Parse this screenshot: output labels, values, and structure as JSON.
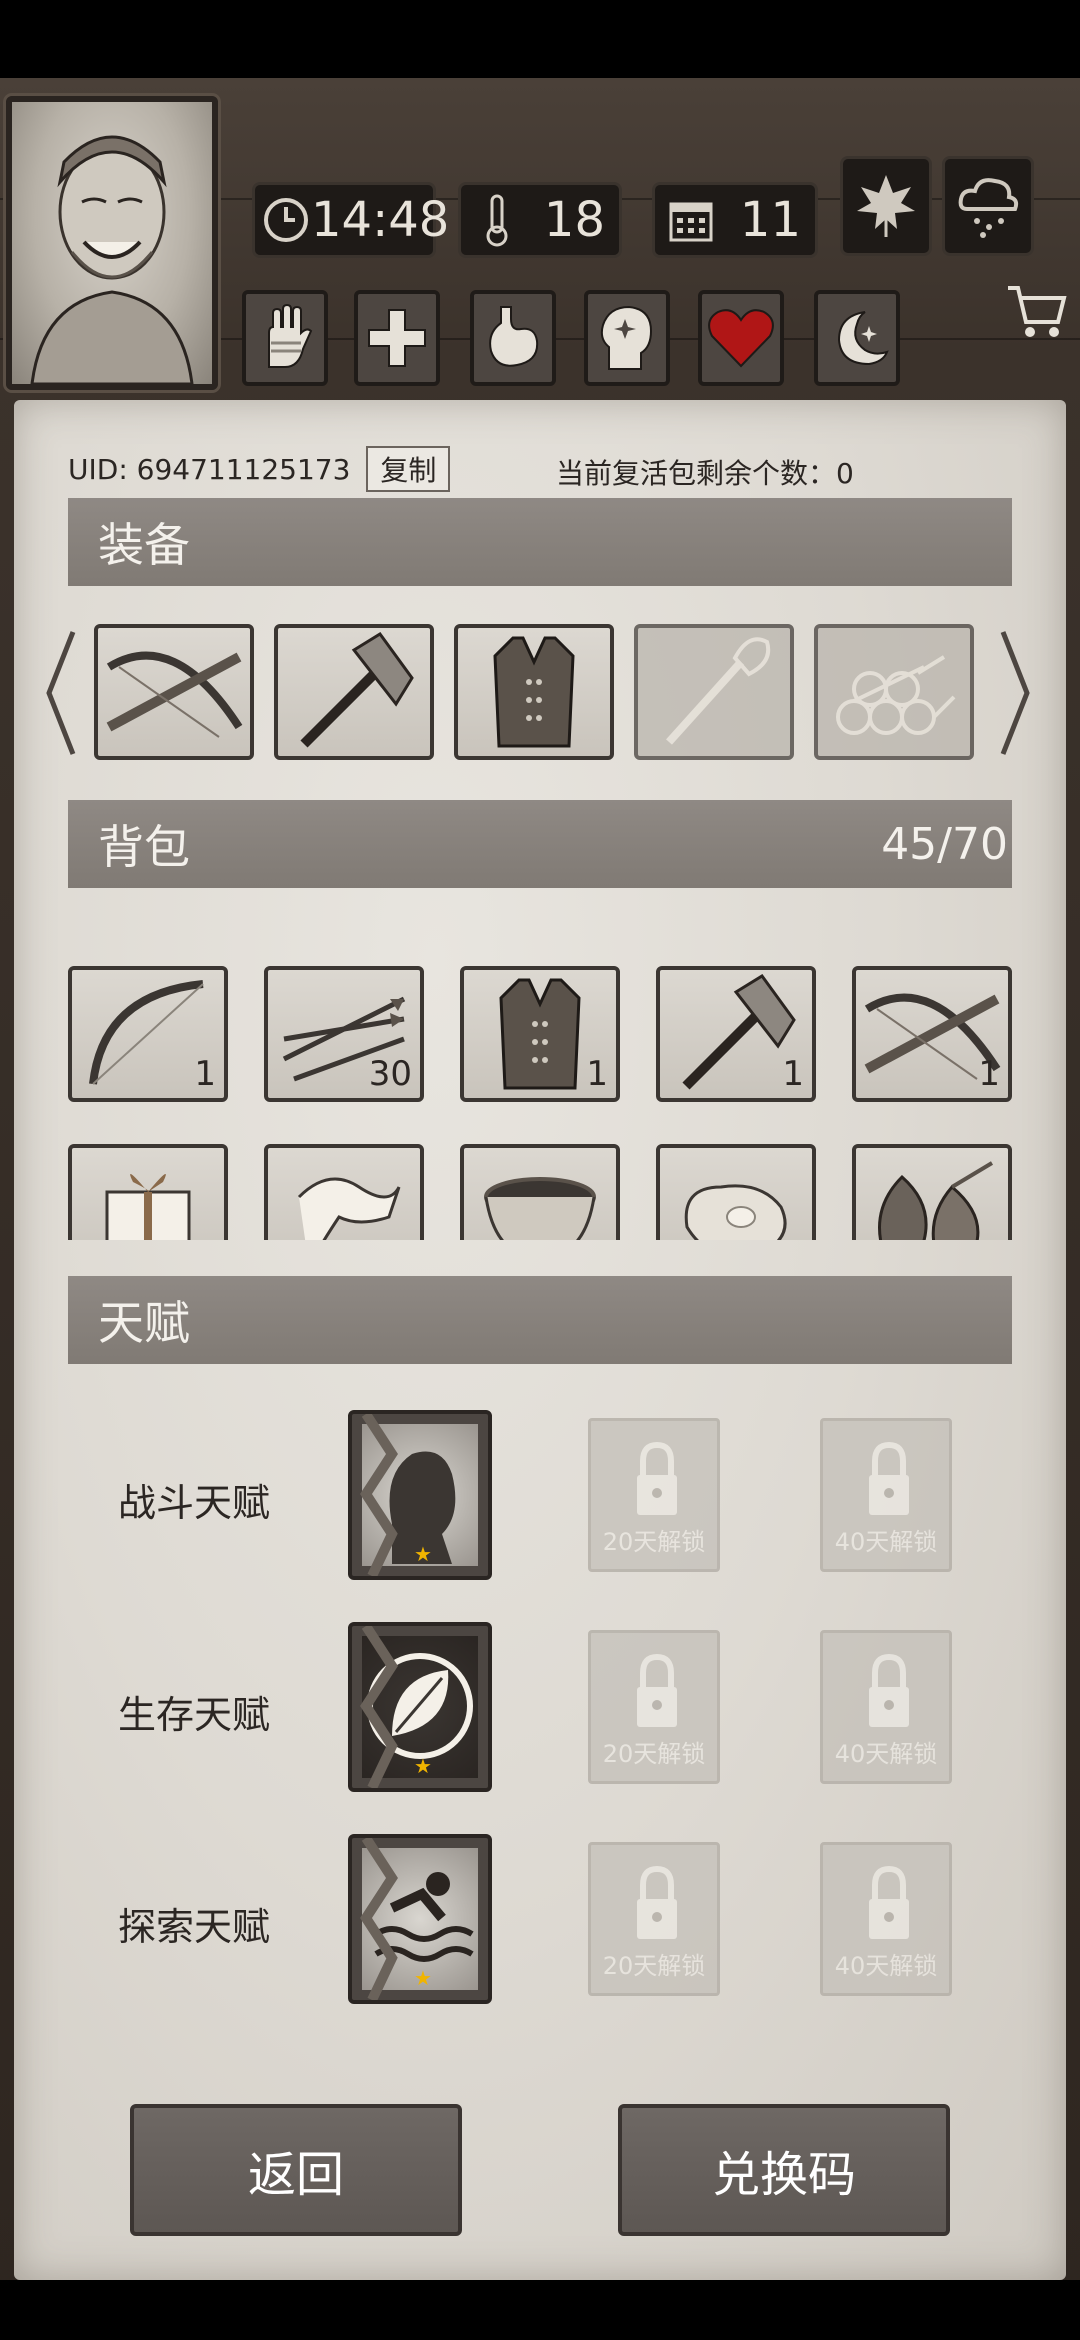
{
  "status": {
    "time": "14:48",
    "temperature": "18",
    "day": "11"
  },
  "profile": {
    "uid_label": "UID: 694711125173",
    "copy_label": "复制",
    "revive_text": "当前复活包剩余个数：0"
  },
  "equipment": {
    "title": "装备",
    "items": [
      {
        "icon": "crossbow-icon"
      },
      {
        "icon": "axe-icon"
      },
      {
        "icon": "leather-vest-icon"
      },
      {
        "icon": "torch-icon",
        "disabled": true
      },
      {
        "icon": "logs-icon",
        "disabled": true
      }
    ]
  },
  "bag": {
    "title": "背包",
    "capacity": "45/70",
    "row1": [
      {
        "icon": "bow-icon",
        "qty": "1"
      },
      {
        "icon": "arrows-icon",
        "qty": "30"
      },
      {
        "icon": "leather-vest-icon",
        "qty": "1"
      },
      {
        "icon": "axe-icon",
        "qty": "1"
      },
      {
        "icon": "crossbow-icon",
        "qty": "1"
      }
    ],
    "row2": [
      {
        "icon": "gift-box-icon"
      },
      {
        "icon": "cloth-icon"
      },
      {
        "icon": "bowl-icon"
      },
      {
        "icon": "meat-icon"
      },
      {
        "icon": "nuts-icon"
      }
    ]
  },
  "talents": {
    "title": "天赋",
    "rows": [
      {
        "label": "战斗天赋",
        "icon": "fighter-portrait-icon",
        "locked": [
          "20天解锁",
          "40天解锁"
        ]
      },
      {
        "label": "生存天赋",
        "icon": "leaf-emblem-icon",
        "locked": [
          "20天解锁",
          "40天解锁"
        ]
      },
      {
        "label": "探索天赋",
        "icon": "swimmer-emblem-icon",
        "locked": [
          "20天解锁",
          "40天解锁"
        ]
      }
    ]
  },
  "buttons": {
    "back": "返回",
    "redeem": "兑换码"
  }
}
